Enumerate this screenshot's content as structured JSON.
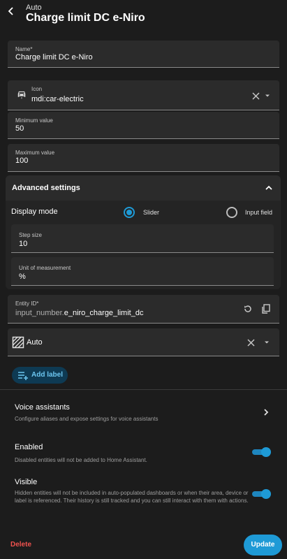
{
  "header": {
    "subtitle": "Auto",
    "title": "Charge limit DC e-Niro"
  },
  "name_field": {
    "label": "Name*",
    "value": "Charge limit DC e-Niro"
  },
  "icon_field": {
    "label": "Icon",
    "value": "mdi:car-electric",
    "icon": "car-electric-icon"
  },
  "min_field": {
    "label": "Minimum value",
    "value": "50"
  },
  "max_field": {
    "label": "Maximum value",
    "value": "100"
  },
  "advanced": {
    "title": "Advanced settings",
    "display_mode_label": "Display mode",
    "options": [
      "Slider",
      "Input field"
    ],
    "selected": "Slider",
    "step": {
      "label": "Step size",
      "value": "10"
    },
    "unit": {
      "label": "Unit of measurement",
      "value": "%"
    }
  },
  "entity_id": {
    "label": "Entity ID*",
    "prefix": "input_number.",
    "value": "e_niro_charge_limit_dc"
  },
  "area": {
    "value": "Auto"
  },
  "add_label": "Add label",
  "voice": {
    "title": "Voice assistants",
    "desc": "Configure aliases and expose settings for voice assistants"
  },
  "enabled": {
    "title": "Enabled",
    "desc": "Disabled entities will not be added to Home Assistant.",
    "on": true
  },
  "visible": {
    "title": "Visible",
    "desc": "Hidden entities will not be included in auto-populated dashboards or when their area, device or label is referenced. Their history is still tracked and you can still interact with them with actions.",
    "on": true
  },
  "actions": {
    "delete": "Delete",
    "update": "Update"
  },
  "colors": {
    "accent": "#1e9ad6",
    "danger": "#f0524e",
    "background": "#1c1c1c",
    "surface": "#2b2b2b"
  }
}
